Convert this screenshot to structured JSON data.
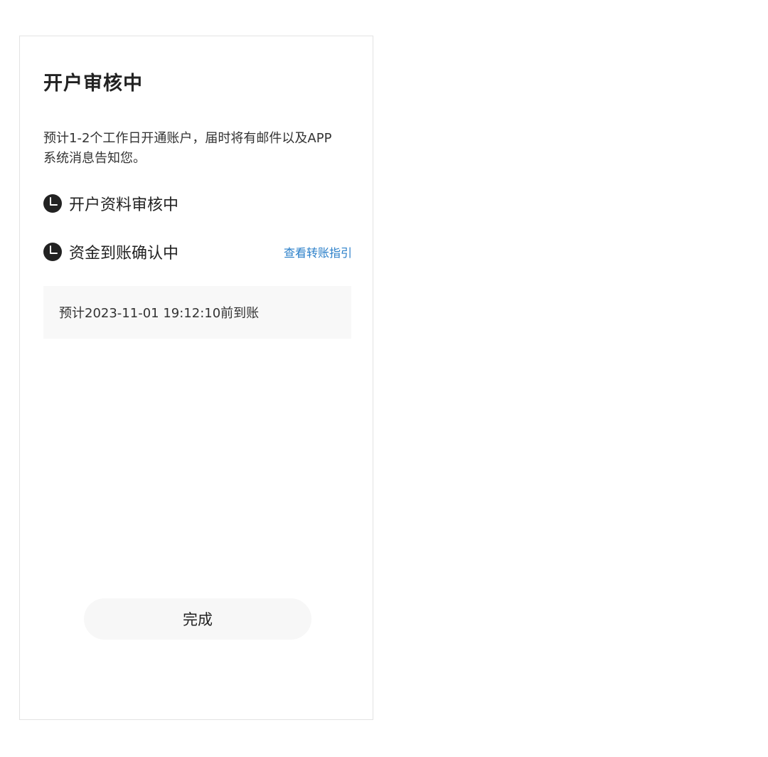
{
  "card": {
    "title": "开户审核中",
    "description": "预计1-2个工作日开通账户，届时将有邮件以及APP系统消息告知您。",
    "steps": [
      {
        "label": "开户资料审核中",
        "icon": "clock-icon"
      },
      {
        "label": "资金到账确认中",
        "icon": "clock-icon",
        "link": "查看转账指引"
      }
    ],
    "eta": "预计2023-11-01 19:12:10前到账",
    "done_label": "完成"
  },
  "colors": {
    "link": "#2a7fc9",
    "icon": "#222222",
    "eta_background": "#f8f8f8",
    "button_background": "#f7f7f7"
  }
}
